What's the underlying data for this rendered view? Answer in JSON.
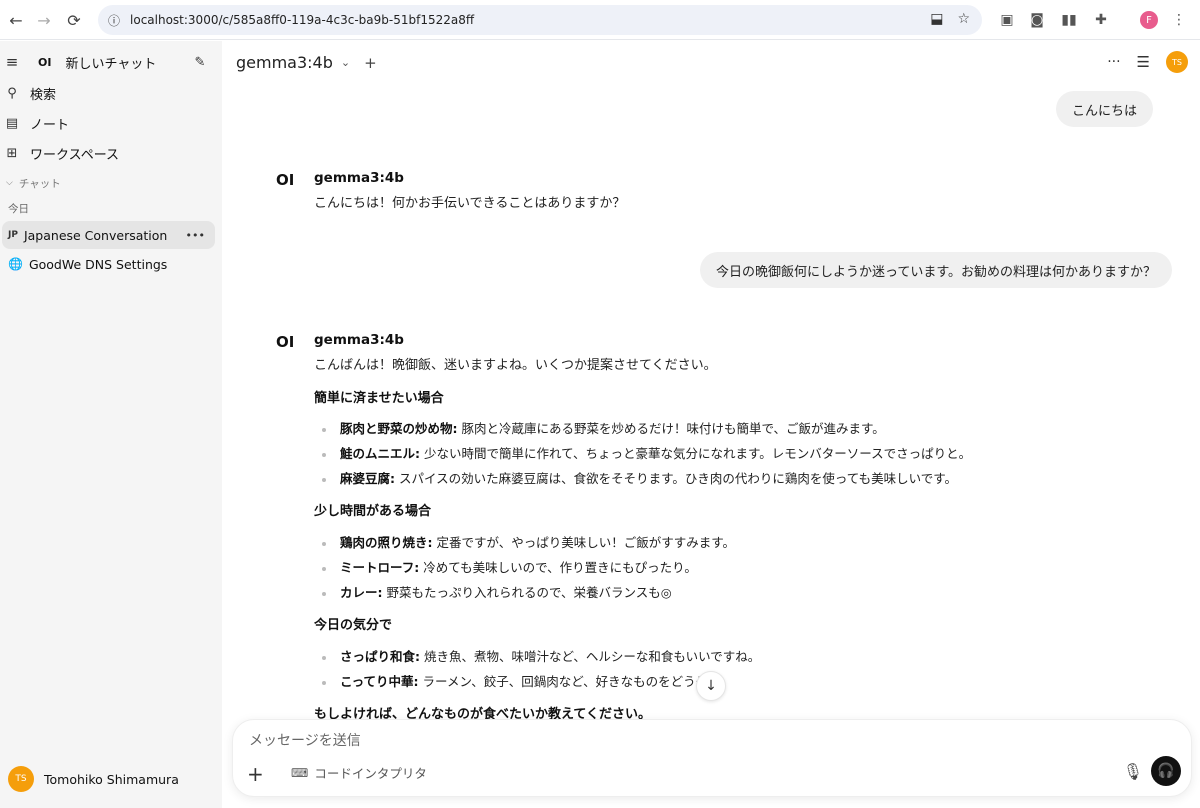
{
  "browser": {
    "url": "localhost:3000/c/585a8ff0-119a-4c3c-ba9b-51bf1522a8ff",
    "profile_initial": "F"
  },
  "sidebar": {
    "new_chat_label": "新しいチャット",
    "logo_text": "OI",
    "nav": [
      {
        "label": "検索"
      },
      {
        "label": "ノート"
      },
      {
        "label": "ワークスペース"
      }
    ],
    "section_label": "チャット",
    "group_label": "今日",
    "chats": [
      {
        "badge": "JP",
        "title": "Japanese Conversation",
        "more": "•••"
      },
      {
        "badge": "🌐",
        "title": "GoodWe DNS Settings"
      }
    ],
    "user": {
      "initials": "TS",
      "name": "Tomohiko Shimamura"
    }
  },
  "header": {
    "model": "gemma3:4b",
    "add_symbol": "+",
    "more": "···",
    "avatar_initials": "TS"
  },
  "messages": {
    "user1": "こんにちは",
    "ai1": {
      "logo": "OI",
      "name": "gemma3:4b",
      "text": "こんにちは！何かお手伝いできることはありますか？"
    },
    "user2": "今日の晩御飯何にしようか迷っています。お勧めの料理は何かありますか？",
    "ai2": {
      "logo": "OI",
      "name": "gemma3:4b",
      "intro": "こんばんは！晩御飯、迷いますよね。いくつか提案させてください。",
      "sections": [
        {
          "heading": "簡単に済ませたい場合",
          "items": [
            {
              "title": "豚肉と野菜の炒め物:",
              "desc": " 豚肉と冷蔵庫にある野菜を炒めるだけ！味付けも簡単で、ご飯が進みます。"
            },
            {
              "title": "鮭のムニエル:",
              "desc": " 少ない時間で簡単に作れて、ちょっと豪華な気分になれます。レモンバターソースでさっぱりと。"
            },
            {
              "title": "麻婆豆腐:",
              "desc": " スパイスの効いた麻婆豆腐は、食欲をそそります。ひき肉の代わりに鶏肉を使っても美味しいです。"
            }
          ]
        },
        {
          "heading": "少し時間がある場合",
          "items": [
            {
              "title": "鶏肉の照り焼き:",
              "desc": " 定番ですが、やっぱり美味しい！ご飯がすすみます。"
            },
            {
              "title": "ミートローフ:",
              "desc": " 冷めても美味しいので、作り置きにもぴったり。"
            },
            {
              "title": "カレー:",
              "desc": " 野菜もたっぷり入れられるので、栄養バランスも◎"
            }
          ]
        },
        {
          "heading": "今日の気分で",
          "items": [
            {
              "title": "さっぱり和食:",
              "desc": " 焼き魚、煮物、味噌汁など、ヘルシーな和食もいいですね。"
            },
            {
              "title": "こってり中華:",
              "desc": " ラーメン、餃子、回鍋肉など、好きなものをどうぞ！"
            }
          ]
        }
      ],
      "closing": "もしよければ、どんなものが食べたいか教えてください。"
    }
  },
  "composer": {
    "placeholder": "メッセージを送信",
    "code_interpreter": "コードインタプリタ"
  }
}
